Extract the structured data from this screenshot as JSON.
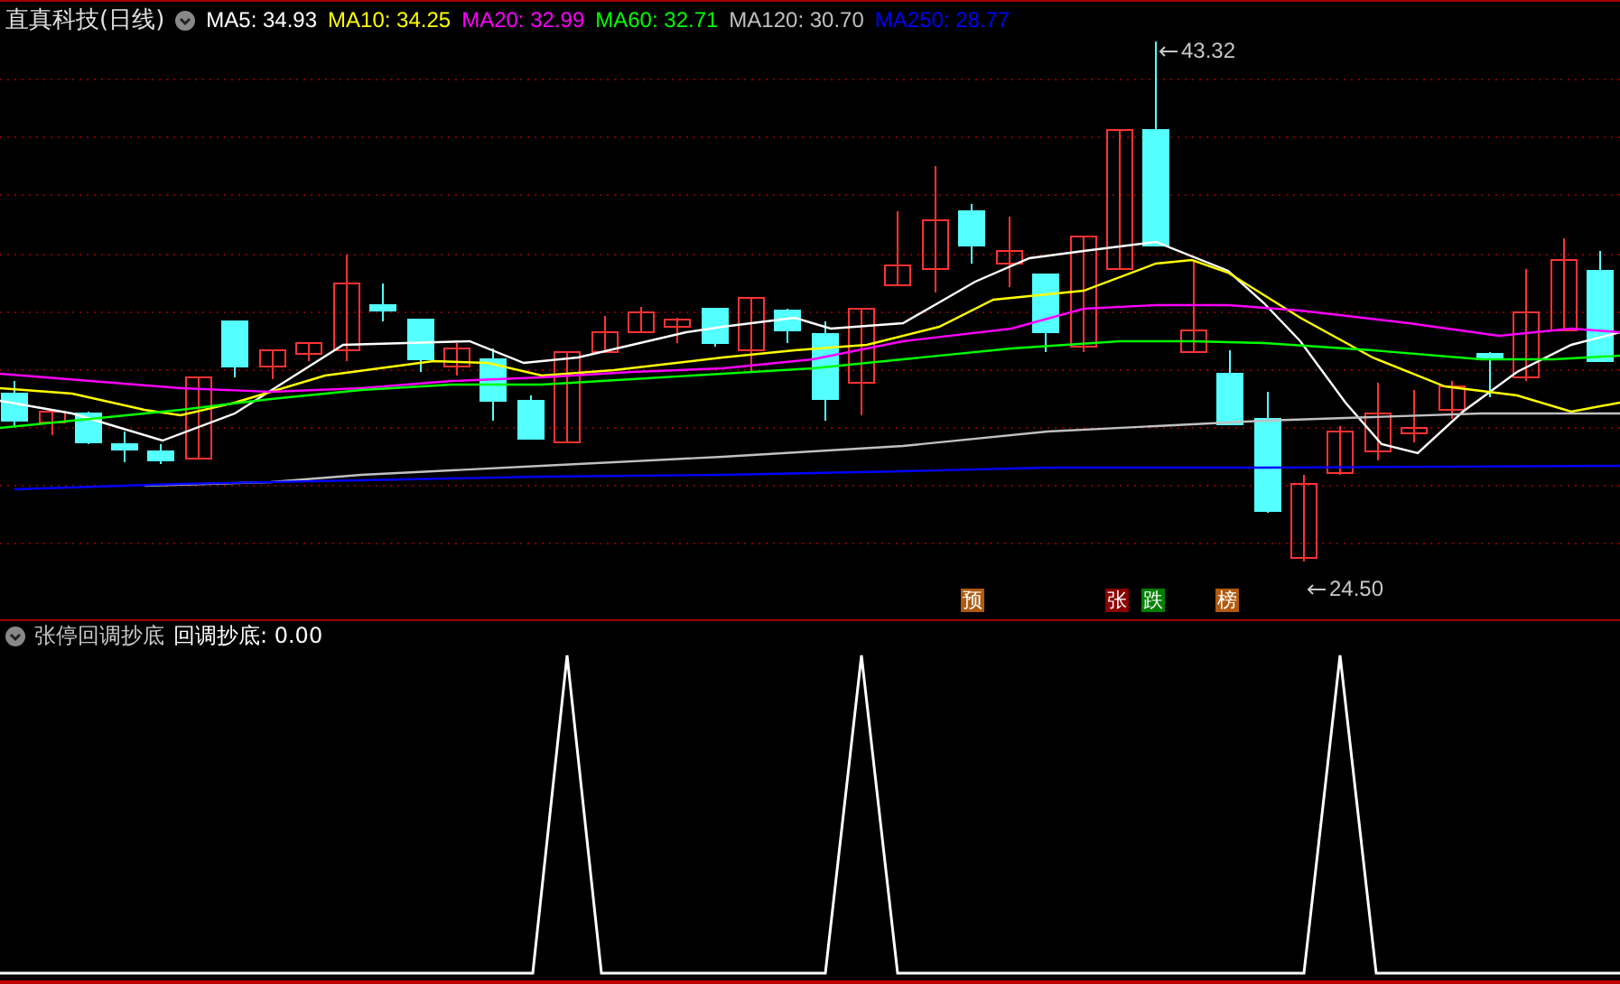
{
  "title": "直真科技(日线)",
  "ma_legend": [
    {
      "label": "MA5: 34.93",
      "color": "#ffffff"
    },
    {
      "label": "MA10: 34.25",
      "color": "#ffff00"
    },
    {
      "label": "MA20: 32.99",
      "color": "#ff00ff"
    },
    {
      "label": "MA60: 32.71",
      "color": "#00ff00"
    },
    {
      "label": "MA120: 30.70",
      "color": "#c0c0c0"
    },
    {
      "label": "MA250: 28.77",
      "color": "#0000ff"
    }
  ],
  "max_label": "43.32",
  "min_label": "24.50",
  "signal_badges": [
    {
      "label": "预",
      "color": "#b05a10"
    },
    {
      "label": "张",
      "color": "#8b0000"
    },
    {
      "label": "跌",
      "color": "#008000"
    },
    {
      "label": "榜",
      "color": "#b05a10"
    }
  ],
  "indicator": {
    "title": "张停回调抄底",
    "reading": "回调抄底: 0.00"
  }
}
